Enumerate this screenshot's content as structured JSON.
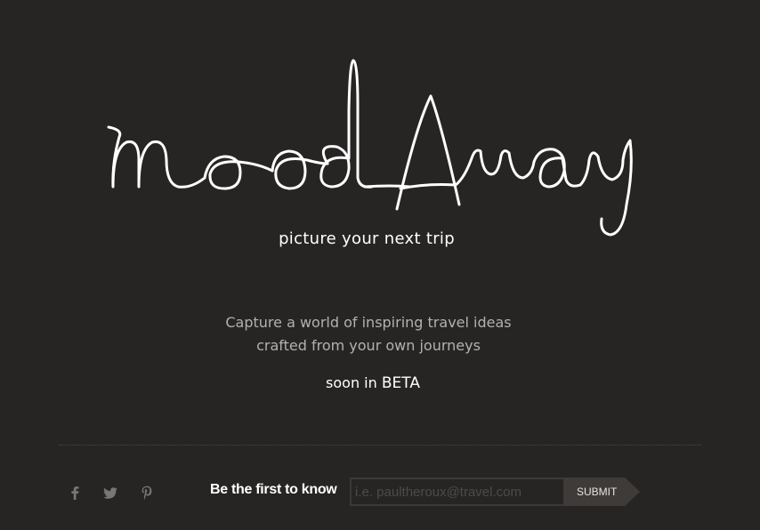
{
  "brand": {
    "logo_text": "moodAway",
    "tagline": "picture your next trip"
  },
  "intro": {
    "line1": "Capture a world of inspiring travel ideas",
    "line2": "crafted from your own journeys"
  },
  "beta": {
    "prefix": "soon in",
    "label": "BETA"
  },
  "footer": {
    "social": [
      {
        "name": "facebook-icon"
      },
      {
        "name": "twitter-icon"
      },
      {
        "name": "pinterest-icon"
      }
    ],
    "signup_label": "Be the first to know",
    "email_placeholder": "i.e. paultheroux@travel.com",
    "email_value": "",
    "submit_label": "SUBMIT"
  },
  "colors": {
    "background": "#272524",
    "text_primary": "#ffffff",
    "text_muted": "#b4b0ac",
    "icon": "#7a7673",
    "button_bg": "#3e3b39"
  }
}
